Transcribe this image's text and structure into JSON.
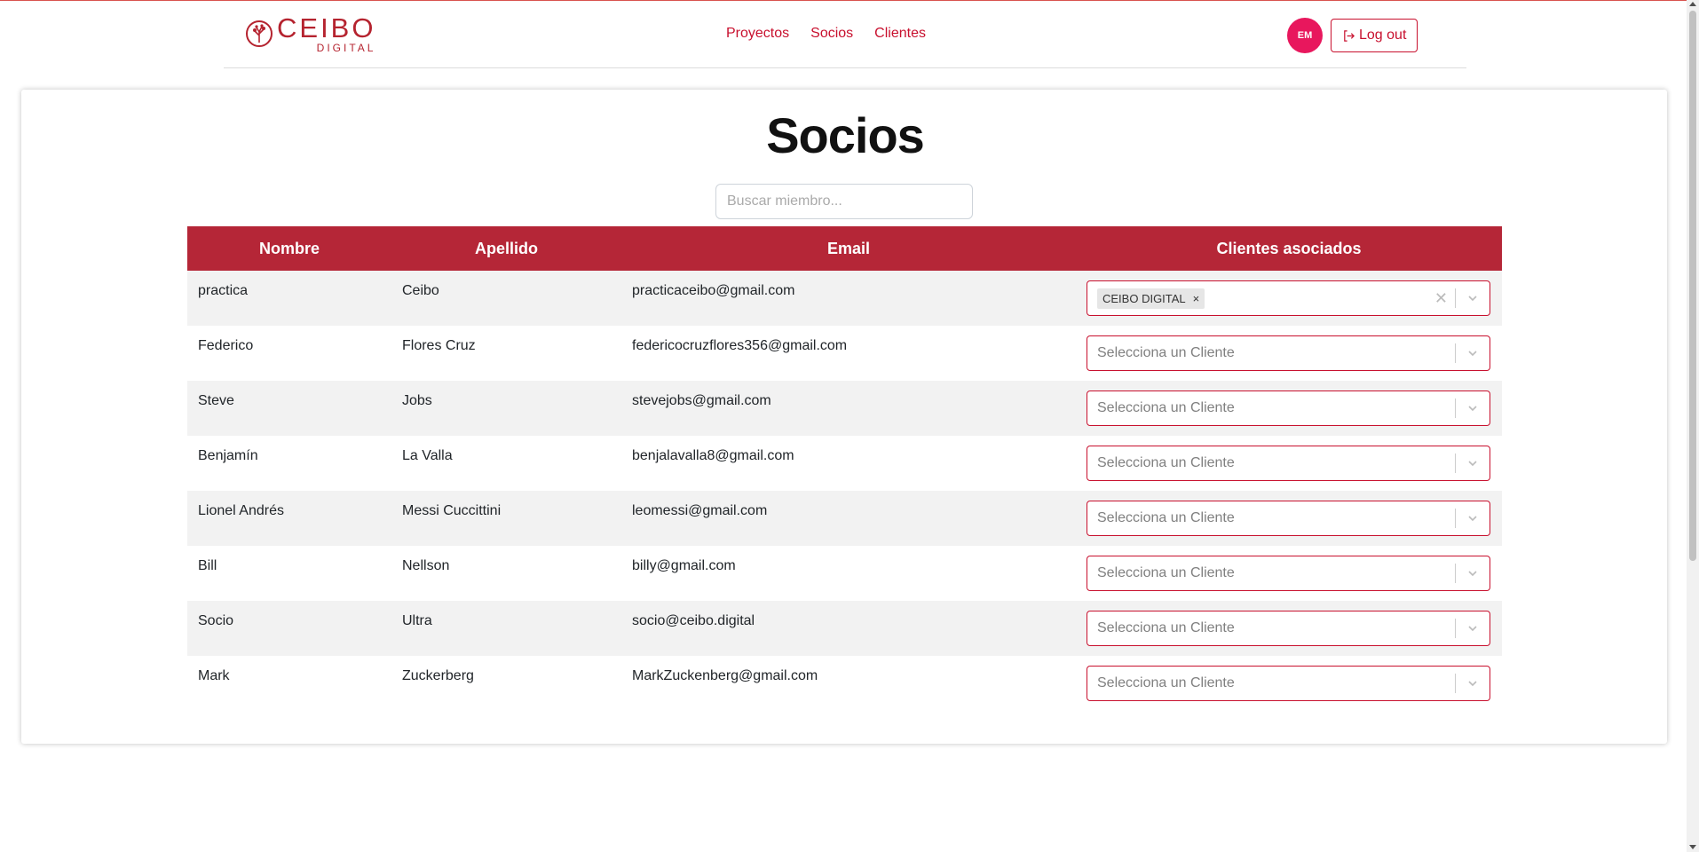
{
  "brand": {
    "name": "CEIBO",
    "sub": "DIGITAL",
    "color": "#b5232f"
  },
  "nav": {
    "links": [
      "Proyectos",
      "Socios",
      "Clientes"
    ],
    "avatar_initials": "EM",
    "logout_label": "Log out"
  },
  "page": {
    "title": "Socios",
    "search_placeholder": "Buscar miembro..."
  },
  "table": {
    "headers": [
      "Nombre",
      "Apellido",
      "Email",
      "Clientes asociados"
    ],
    "select_placeholder": "Selecciona un Cliente",
    "rows": [
      {
        "nombre": "practica",
        "apellido": "Ceibo",
        "email": "practicaceibo@gmail.com",
        "clientes": [
          "CEIBO DIGITAL"
        ]
      },
      {
        "nombre": "Federico",
        "apellido": "Flores Cruz",
        "email": "federicocruzflores356@gmail.com",
        "clientes": []
      },
      {
        "nombre": "Steve",
        "apellido": "Jobs",
        "email": "stevejobs@gmail.com",
        "clientes": []
      },
      {
        "nombre": "Benjamín",
        "apellido": "La Valla",
        "email": "benjalavalla8@gmail.com",
        "clientes": []
      },
      {
        "nombre": "Lionel Andrés",
        "apellido": "Messi Cuccittini",
        "email": "leomessi@gmail.com",
        "clientes": []
      },
      {
        "nombre": "Bill",
        "apellido": "Nellson",
        "email": "billy@gmail.com",
        "clientes": []
      },
      {
        "nombre": "Socio",
        "apellido": "Ultra",
        "email": "socio@ceibo.digital",
        "clientes": []
      },
      {
        "nombre": "Mark",
        "apellido": "Zuckerberg",
        "email": "MarkZuckenberg@gmail.com",
        "clientes": []
      }
    ]
  },
  "colors": {
    "header_bg": "#b52637",
    "accent": "#c8102e",
    "avatar_bg": "#e8175d",
    "row_alt": "#f2f2f2"
  },
  "icons": {
    "logout": "logout-icon",
    "chevron": "chevron-down-icon",
    "clear": "clear-icon",
    "logo": "tree-logo-icon"
  }
}
